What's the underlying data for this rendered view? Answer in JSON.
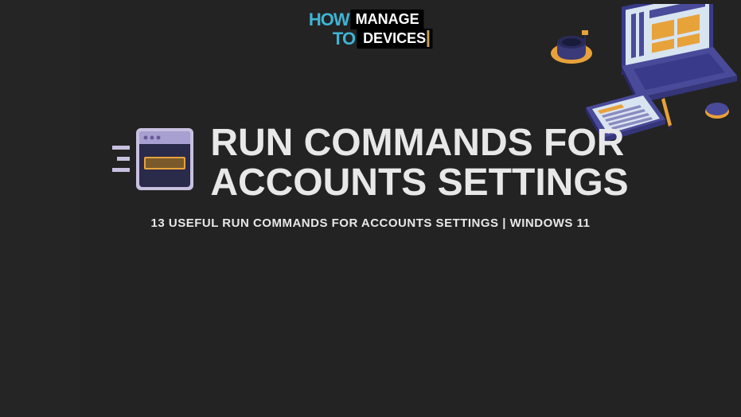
{
  "logo": {
    "word1": "HOW",
    "word2": "MANAGE",
    "word3": "TO",
    "word4": "DEVICES"
  },
  "heading": {
    "line1": "RUN COMMANDS FOR",
    "line2": "ACCOUNTS SETTINGS"
  },
  "subtitle": "13 USEFUL RUN COMMANDS FOR ACCOUNTS SETTINGS | WINDOWS 11",
  "colors": {
    "accent_cyan": "#3fb4d4",
    "accent_orange": "#e8a23a",
    "accent_purple": "#4a4a9a",
    "bg": "#252525"
  }
}
